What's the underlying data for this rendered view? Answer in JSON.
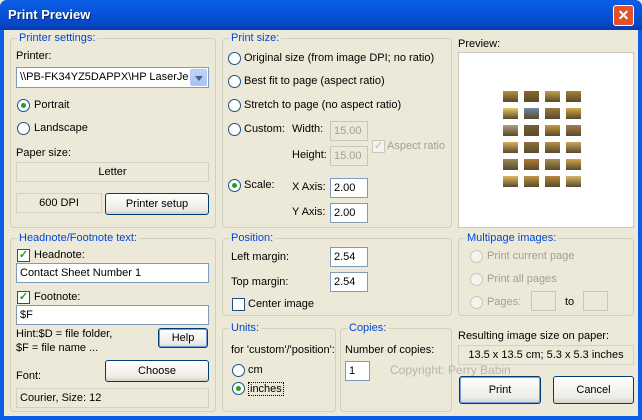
{
  "window": {
    "title": "Print Preview",
    "close_glyph": "✕"
  },
  "printer_settings": {
    "group_title": "Printer settings:",
    "printer_label": "Printer:",
    "printer_value": "\\\\PB-FK34YZ5DAPPX\\HP LaserJe",
    "orientation": {
      "portrait": "Portrait",
      "landscape": "Landscape",
      "selected": "portrait"
    },
    "paper_size_label": "Paper size:",
    "paper_size_value": "Letter",
    "dpi": "600 DPI",
    "setup_button": "Printer setup"
  },
  "print_size": {
    "group_title": "Print size:",
    "options": [
      "Original size (from image DPI; no ratio)",
      "Best fit to page (aspect ratio)",
      "Stretch to page (no aspect ratio)",
      "Custom:",
      "Scale:"
    ],
    "selected": "Scale:",
    "width_label": "Width:",
    "width_value": "15.00",
    "height_label": "Height:",
    "height_value": "15.00",
    "aspect_ratio": "Aspect ratio",
    "x_axis_label": "X Axis:",
    "x_axis_value": "2.00",
    "y_axis_label": "Y Axis:",
    "y_axis_value": "2.00"
  },
  "preview": {
    "label": "Preview:",
    "thumb_colors": [
      "#b8923a",
      "#8a6a2a",
      "#c4a04a",
      "#a4823e",
      "#e8c868",
      "#6d8aa4",
      "#9b7a3c",
      "#d2a848",
      "#b0a07a",
      "#7a6030",
      "#c89a40",
      "#a08050",
      "#d8b060",
      "#8c7040",
      "#b89048",
      "#c8a858",
      "#9a8860",
      "#b07a38",
      "#a89058",
      "#d0a850",
      "#e0b860",
      "#c09848",
      "#b88840",
      "#d8b868"
    ]
  },
  "headnote": {
    "group_title": "Headnote/Footnote text:",
    "headnote_label": "Headnote:",
    "headnote_checked": true,
    "headnote_value": "Contact Sheet Number 1",
    "footnote_label": "Footnote:",
    "footnote_checked": true,
    "footnote_value": "$F",
    "hint_line1": "Hint:$D = file folder,",
    "hint_line2": "$F = file name ...",
    "help_button": "Help",
    "font_label": "Font:",
    "choose_button": "Choose",
    "font_value": "Courier, Size: 12"
  },
  "position": {
    "group_title": "Position:",
    "left_margin_label": "Left margin:",
    "left_margin_value": "2.54",
    "top_margin_label": "Top margin:",
    "top_margin_value": "2.54",
    "center_image": "Center image"
  },
  "multipage": {
    "group_title": "Multipage images:",
    "print_current": "Print current page",
    "print_all": "Print all pages",
    "pages": "Pages:",
    "to": "to"
  },
  "units": {
    "group_title": "Units:",
    "description": "for 'custom'/'position':",
    "cm": "cm",
    "inches": "inches",
    "selected": "inches"
  },
  "copies": {
    "group_title": "Copies:",
    "label": "Number of copies:",
    "value": "1"
  },
  "result": {
    "label": "Resulting image size on paper:",
    "value": "13.5 x 13.5 cm; 5.3 x 5.3 inches"
  },
  "watermark": "Copyright: Perry Babin",
  "buttons": {
    "print": "Print",
    "cancel": "Cancel"
  }
}
